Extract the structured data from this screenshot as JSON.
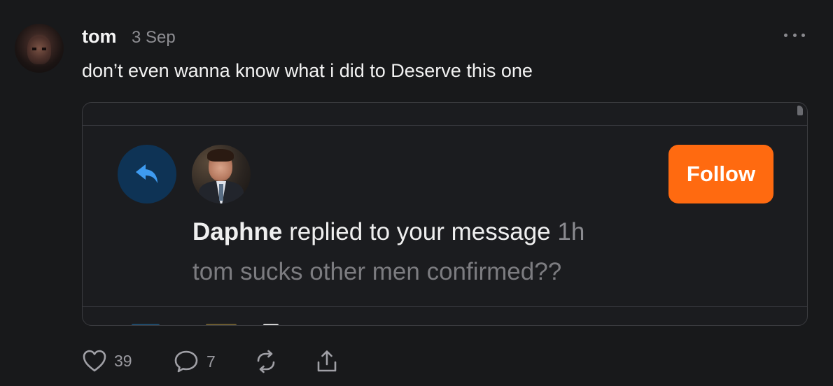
{
  "post": {
    "username": "tom",
    "timestamp": "3 Sep",
    "text": "don’t even wanna know what i did to Deserve this one"
  },
  "embed": {
    "follow_label": "Follow",
    "sender": "Daphne",
    "action_text": "replied to your message",
    "time": "1h",
    "message": "tom sucks other men confirmed??"
  },
  "actions": {
    "likes": "39",
    "comments": "7"
  },
  "colors": {
    "background": "#18191b",
    "follow_button": "#ff6a10",
    "reply_badge": "#0e3355",
    "reply_arrow": "#3e9bf0"
  },
  "icons": [
    "more-icon",
    "reply-arrow-icon",
    "heart-icon",
    "comment-icon",
    "repost-icon",
    "share-icon"
  ]
}
